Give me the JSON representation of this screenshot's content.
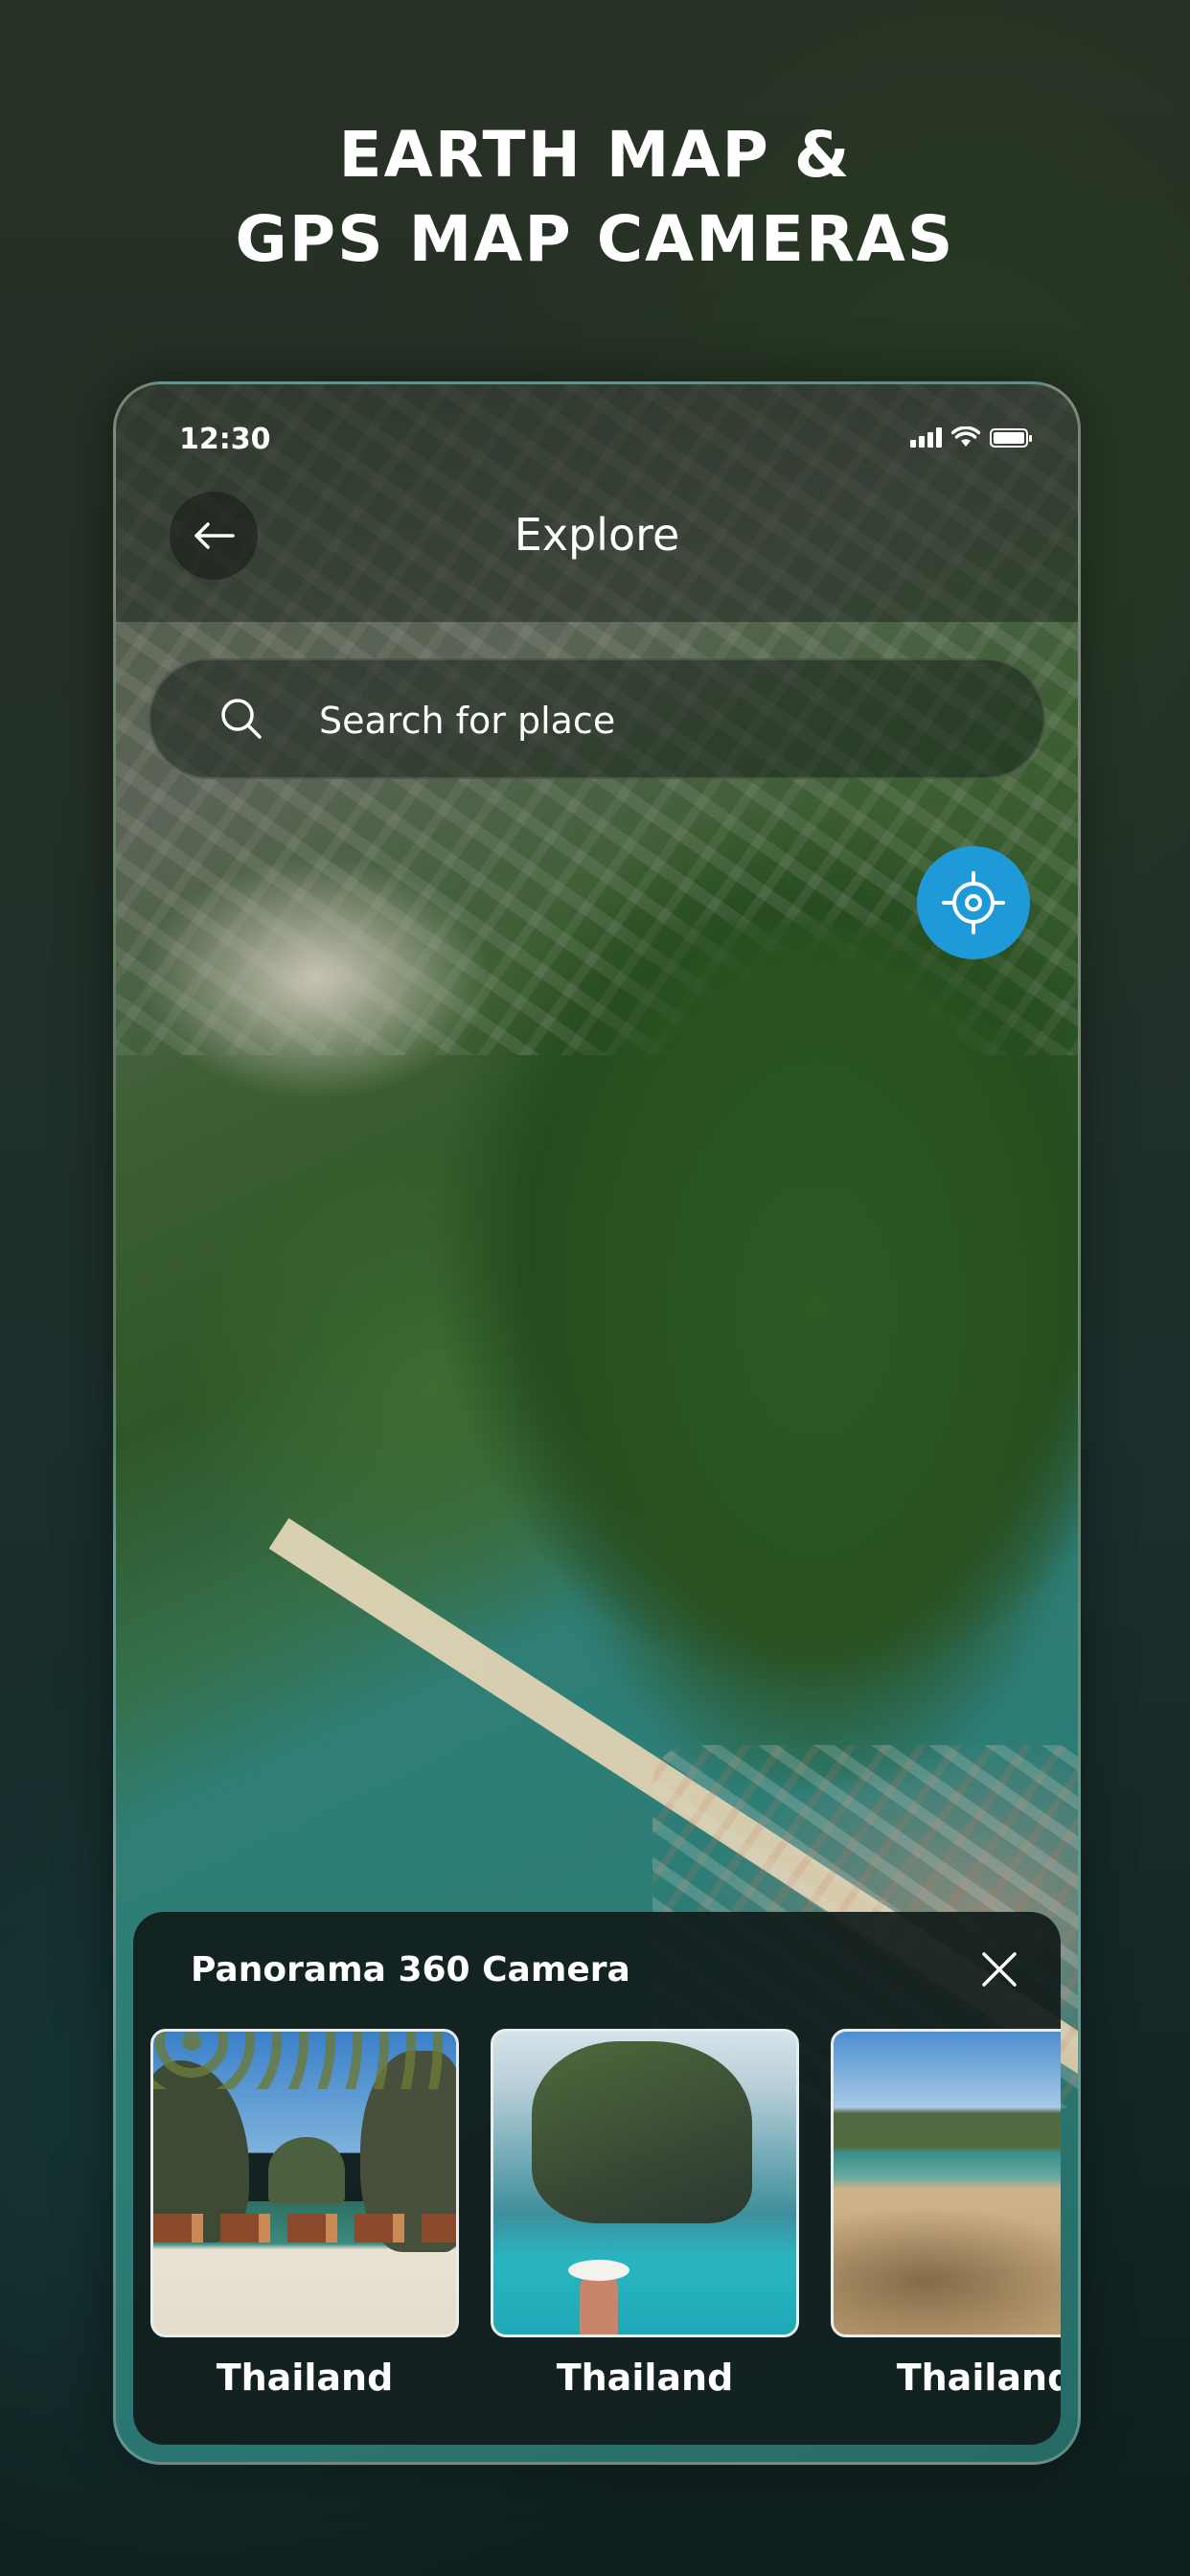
{
  "headline": {
    "line1": "EARTH MAP &",
    "line2": "GPS MAP CAMERAS"
  },
  "statusbar": {
    "time": "12:30"
  },
  "appbar": {
    "title": "Explore"
  },
  "search": {
    "placeholder": "Search for place"
  },
  "sheet": {
    "title": "Panorama 360 Camera",
    "cards": [
      {
        "label": "Thailand"
      },
      {
        "label": "Thailand"
      },
      {
        "label": "Thailand"
      }
    ]
  },
  "colors": {
    "locate_button": "#1e9ad9",
    "sheet_background": "#111c1b"
  },
  "icons": [
    "back-arrow-icon",
    "search-icon",
    "crosshair-icon",
    "close-icon",
    "signal-icon",
    "wifi-icon",
    "battery-icon"
  ]
}
